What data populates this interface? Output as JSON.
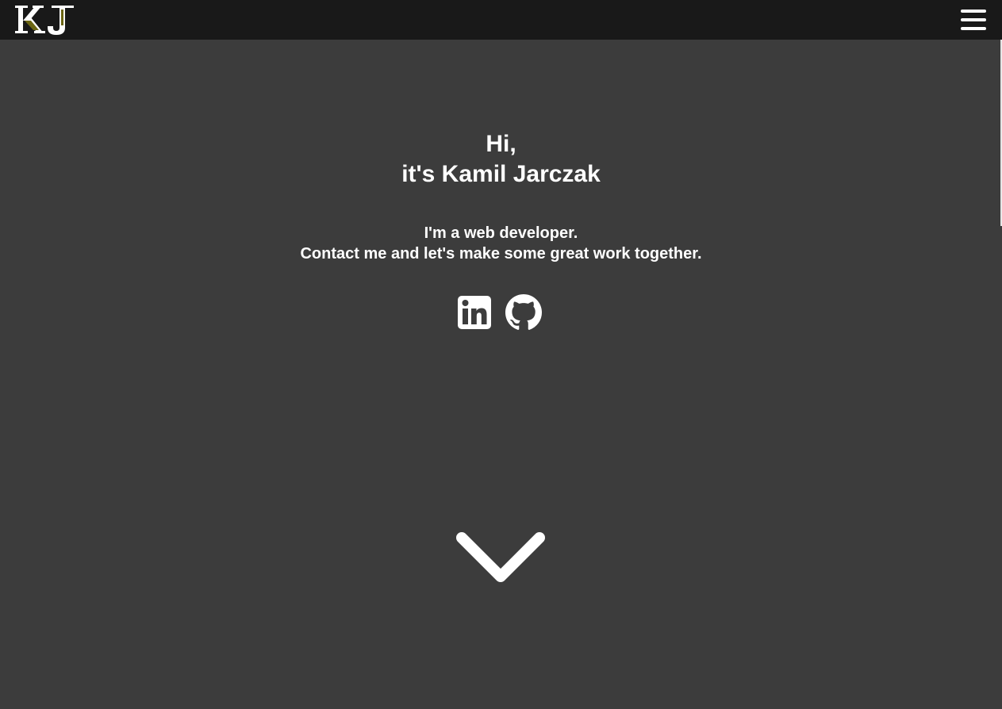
{
  "header": {
    "logo_text": "KJ",
    "menu_icon": "hamburger-menu-icon"
  },
  "hero": {
    "greeting_line1": "Hi,",
    "greeting_line2": "it's Kamil Jarczak",
    "tagline_line1": "I'm a web developer.",
    "tagline_line2": "Contact me and let's make some great work together."
  },
  "socials": [
    {
      "icon": "linkedin-icon"
    },
    {
      "icon": "github-icon"
    }
  ],
  "scroll_icon": "chevron-down-icon",
  "colors": {
    "navbar_bg": "#191919",
    "page_bg": "#3c3c3c",
    "text": "#ffffff",
    "logo_accent": "#6b6512"
  }
}
